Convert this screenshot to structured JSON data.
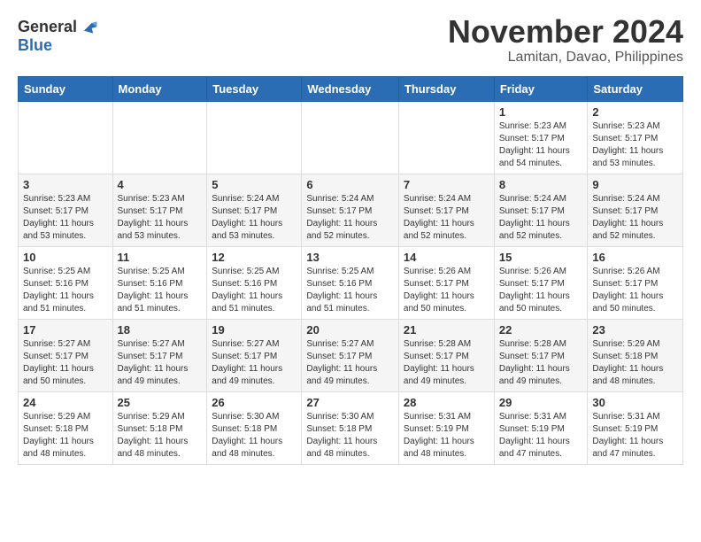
{
  "header": {
    "logo_general": "General",
    "logo_blue": "Blue",
    "month_title": "November 2024",
    "location": "Lamitan, Davao, Philippines"
  },
  "calendar": {
    "headers": [
      "Sunday",
      "Monday",
      "Tuesday",
      "Wednesday",
      "Thursday",
      "Friday",
      "Saturday"
    ],
    "weeks": [
      [
        {
          "day": "",
          "info": ""
        },
        {
          "day": "",
          "info": ""
        },
        {
          "day": "",
          "info": ""
        },
        {
          "day": "",
          "info": ""
        },
        {
          "day": "",
          "info": ""
        },
        {
          "day": "1",
          "info": "Sunrise: 5:23 AM\nSunset: 5:17 PM\nDaylight: 11 hours\nand 54 minutes."
        },
        {
          "day": "2",
          "info": "Sunrise: 5:23 AM\nSunset: 5:17 PM\nDaylight: 11 hours\nand 53 minutes."
        }
      ],
      [
        {
          "day": "3",
          "info": "Sunrise: 5:23 AM\nSunset: 5:17 PM\nDaylight: 11 hours\nand 53 minutes."
        },
        {
          "day": "4",
          "info": "Sunrise: 5:23 AM\nSunset: 5:17 PM\nDaylight: 11 hours\nand 53 minutes."
        },
        {
          "day": "5",
          "info": "Sunrise: 5:24 AM\nSunset: 5:17 PM\nDaylight: 11 hours\nand 53 minutes."
        },
        {
          "day": "6",
          "info": "Sunrise: 5:24 AM\nSunset: 5:17 PM\nDaylight: 11 hours\nand 52 minutes."
        },
        {
          "day": "7",
          "info": "Sunrise: 5:24 AM\nSunset: 5:17 PM\nDaylight: 11 hours\nand 52 minutes."
        },
        {
          "day": "8",
          "info": "Sunrise: 5:24 AM\nSunset: 5:17 PM\nDaylight: 11 hours\nand 52 minutes."
        },
        {
          "day": "9",
          "info": "Sunrise: 5:24 AM\nSunset: 5:17 PM\nDaylight: 11 hours\nand 52 minutes."
        }
      ],
      [
        {
          "day": "10",
          "info": "Sunrise: 5:25 AM\nSunset: 5:16 PM\nDaylight: 11 hours\nand 51 minutes."
        },
        {
          "day": "11",
          "info": "Sunrise: 5:25 AM\nSunset: 5:16 PM\nDaylight: 11 hours\nand 51 minutes."
        },
        {
          "day": "12",
          "info": "Sunrise: 5:25 AM\nSunset: 5:16 PM\nDaylight: 11 hours\nand 51 minutes."
        },
        {
          "day": "13",
          "info": "Sunrise: 5:25 AM\nSunset: 5:16 PM\nDaylight: 11 hours\nand 51 minutes."
        },
        {
          "day": "14",
          "info": "Sunrise: 5:26 AM\nSunset: 5:17 PM\nDaylight: 11 hours\nand 50 minutes."
        },
        {
          "day": "15",
          "info": "Sunrise: 5:26 AM\nSunset: 5:17 PM\nDaylight: 11 hours\nand 50 minutes."
        },
        {
          "day": "16",
          "info": "Sunrise: 5:26 AM\nSunset: 5:17 PM\nDaylight: 11 hours\nand 50 minutes."
        }
      ],
      [
        {
          "day": "17",
          "info": "Sunrise: 5:27 AM\nSunset: 5:17 PM\nDaylight: 11 hours\nand 50 minutes."
        },
        {
          "day": "18",
          "info": "Sunrise: 5:27 AM\nSunset: 5:17 PM\nDaylight: 11 hours\nand 49 minutes."
        },
        {
          "day": "19",
          "info": "Sunrise: 5:27 AM\nSunset: 5:17 PM\nDaylight: 11 hours\nand 49 minutes."
        },
        {
          "day": "20",
          "info": "Sunrise: 5:27 AM\nSunset: 5:17 PM\nDaylight: 11 hours\nand 49 minutes."
        },
        {
          "day": "21",
          "info": "Sunrise: 5:28 AM\nSunset: 5:17 PM\nDaylight: 11 hours\nand 49 minutes."
        },
        {
          "day": "22",
          "info": "Sunrise: 5:28 AM\nSunset: 5:17 PM\nDaylight: 11 hours\nand 49 minutes."
        },
        {
          "day": "23",
          "info": "Sunrise: 5:29 AM\nSunset: 5:18 PM\nDaylight: 11 hours\nand 48 minutes."
        }
      ],
      [
        {
          "day": "24",
          "info": "Sunrise: 5:29 AM\nSunset: 5:18 PM\nDaylight: 11 hours\nand 48 minutes."
        },
        {
          "day": "25",
          "info": "Sunrise: 5:29 AM\nSunset: 5:18 PM\nDaylight: 11 hours\nand 48 minutes."
        },
        {
          "day": "26",
          "info": "Sunrise: 5:30 AM\nSunset: 5:18 PM\nDaylight: 11 hours\nand 48 minutes."
        },
        {
          "day": "27",
          "info": "Sunrise: 5:30 AM\nSunset: 5:18 PM\nDaylight: 11 hours\nand 48 minutes."
        },
        {
          "day": "28",
          "info": "Sunrise: 5:31 AM\nSunset: 5:19 PM\nDaylight: 11 hours\nand 48 minutes."
        },
        {
          "day": "29",
          "info": "Sunrise: 5:31 AM\nSunset: 5:19 PM\nDaylight: 11 hours\nand 47 minutes."
        },
        {
          "day": "30",
          "info": "Sunrise: 5:31 AM\nSunset: 5:19 PM\nDaylight: 11 hours\nand 47 minutes."
        }
      ]
    ]
  }
}
